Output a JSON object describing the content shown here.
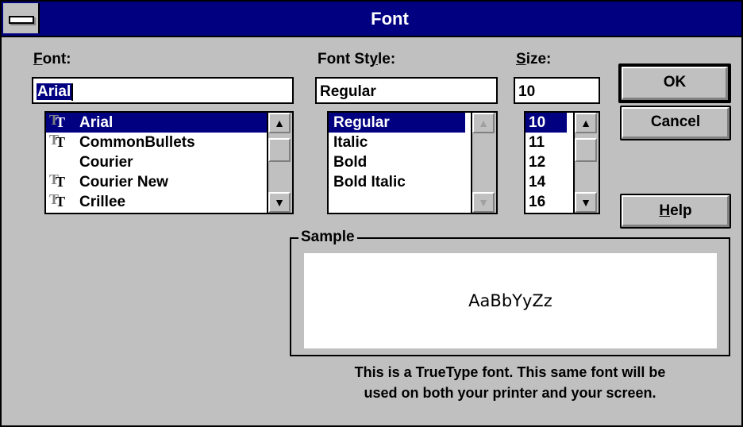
{
  "window": {
    "title": "Font"
  },
  "font": {
    "label_prefix": "",
    "label_ul": "F",
    "label_rest": "ont:",
    "value": "Arial",
    "items": [
      {
        "label": "Arial",
        "truetype": true,
        "selected": true
      },
      {
        "label": "CommonBullets",
        "truetype": true,
        "selected": false
      },
      {
        "label": "Courier",
        "truetype": false,
        "selected": false
      },
      {
        "label": "Courier New",
        "truetype": true,
        "selected": false
      },
      {
        "label": "Crillee",
        "truetype": true,
        "selected": false
      }
    ]
  },
  "style": {
    "label_prefix": "Font St",
    "label_ul": "y",
    "label_rest": "le:",
    "value": "Regular",
    "items": [
      {
        "label": "Regular",
        "selected": true
      },
      {
        "label": "Italic",
        "selected": false
      },
      {
        "label": "Bold",
        "selected": false
      },
      {
        "label": "Bold Italic",
        "selected": false
      }
    ]
  },
  "size": {
    "label_ul": "S",
    "label_rest": "ize:",
    "value": "10",
    "items": [
      {
        "label": "10",
        "selected": true
      },
      {
        "label": "11",
        "selected": false
      },
      {
        "label": "12",
        "selected": false
      },
      {
        "label": "14",
        "selected": false
      },
      {
        "label": "16",
        "selected": false
      }
    ]
  },
  "buttons": {
    "ok": "OK",
    "cancel": "Cancel",
    "help_ul": "H",
    "help_rest": "elp"
  },
  "sample": {
    "title": "Sample",
    "text": "AaBbYyZz"
  },
  "note": {
    "line1": "This is a TrueType font. This same font will be",
    "line2": "used on both your printer and your screen."
  },
  "icons": {
    "truetype": "truetype-icon",
    "up": "▲",
    "down": "▼"
  }
}
